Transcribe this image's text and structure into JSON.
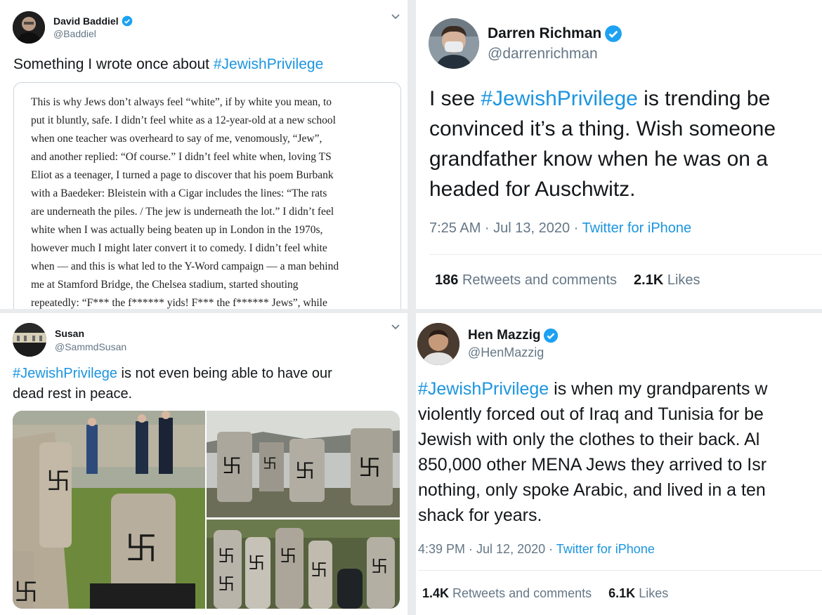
{
  "tweets": [
    {
      "name": "David Baddiel",
      "handle": "@Baddiel",
      "text_prefix": "Something I wrote once about ",
      "hashtag": "#JewishPrivilege",
      "quote_lines": [
        "This is why Jews don’t always feel “white”, if by white you mean, to",
        "put it bluntly, safe. I didn’t feel white as a 12-year-old at a new school",
        "when one teacher was overheard to say of me, venomously, “Jew”,",
        "and another replied: “Of course.” I didn’t feel white when, loving TS",
        "Eliot as a teenager, I turned a page to discover that his poem Burbank",
        "with a Baedeker: Bleistein with a Cigar includes the lines: “The rats",
        "are underneath the piles. / The jew is underneath the lot.” I didn’t feel",
        "white when I was actually being beaten up in London in the 1970s,",
        "however much I might later convert it to comedy. I didn’t feel white",
        "when — and this is what led to the Y-Word campaign — a man behind",
        "me at Stamford Bridge, the Chelsea stadium, started shouting",
        "repeatedly: “F*** the f****** yids! F*** the f****** Jews”, while"
      ]
    },
    {
      "name": "Darren Richman",
      "handle": "@darrenrichman",
      "lines": [
        {
          "pre": "I see ",
          "hash": "#JewishPrivilege",
          "post": " is trending be"
        },
        {
          "pre": "convinced it’s a thing. Wish someone",
          "hash": "",
          "post": ""
        },
        {
          "pre": "grandfather know when he was on a",
          "hash": "",
          "post": ""
        },
        {
          "pre": "headed for Auschwitz.",
          "hash": "",
          "post": ""
        }
      ],
      "time": "7:25 AM · Jul 13, 2020 · ",
      "source": "Twitter for iPhone",
      "retweets": "186",
      "retweets_label": "Retweets and comments",
      "likes": "2.1K",
      "likes_label": "Likes"
    },
    {
      "name": "Susan",
      "handle": "@SammdSusan",
      "lines": [
        {
          "pre": "",
          "hash": "#JewishPrivilege",
          "post": " is not even being able to have our"
        },
        {
          "pre": "dead rest in peace.",
          "hash": "",
          "post": ""
        }
      ]
    },
    {
      "name": "Hen Mazzig",
      "handle": "@HenMazzig",
      "lines": [
        {
          "pre": "",
          "hash": "#JewishPrivilege",
          "post": " is when my grandparents w"
        },
        {
          "pre": "violently forced out of Iraq and Tunisia for be",
          "hash": "",
          "post": ""
        },
        {
          "pre": "Jewish with only the clothes to their back. Al",
          "hash": "",
          "post": ""
        },
        {
          "pre": "850,000 other MENA Jews they arrived to Isr",
          "hash": "",
          "post": ""
        },
        {
          "pre": "nothing, only spoke Arabic, and lived in a ten",
          "hash": "",
          "post": ""
        },
        {
          "pre": "shack for years.",
          "hash": "",
          "post": ""
        }
      ],
      "time": "4:39 PM · Jul 12, 2020 · ",
      "source": "Twitter for iPhone",
      "retweets": "1.4K",
      "retweets_label": "Retweets and comments",
      "likes": "6.1K",
      "likes_label": "Likes"
    }
  ],
  "icons": {
    "verified": "verified-badge-icon",
    "caret": "chevron-down-icon"
  },
  "colors": {
    "link": "#1b95e0",
    "muted": "#657786",
    "verified": "#1da1f2"
  }
}
